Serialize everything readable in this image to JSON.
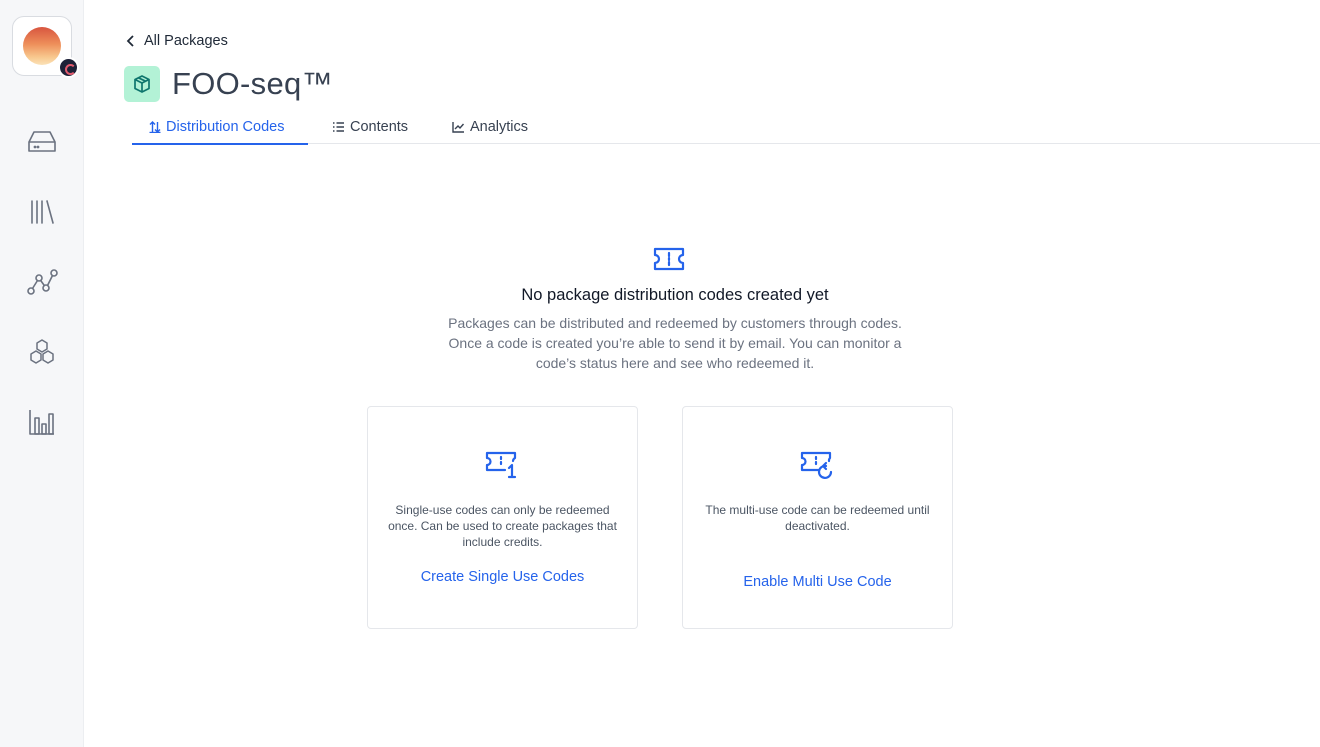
{
  "sidebar": {
    "items": [
      {
        "icon": "inbox-icon"
      },
      {
        "icon": "library-icon"
      },
      {
        "icon": "workflow-icon"
      },
      {
        "icon": "hexagons-icon"
      },
      {
        "icon": "bar-chart-icon"
      }
    ]
  },
  "header": {
    "back_label": "All Packages",
    "title": "FOO-seq™"
  },
  "tabs": [
    {
      "label": "Distribution Codes",
      "active": true
    },
    {
      "label": "Contents",
      "active": false
    },
    {
      "label": "Analytics",
      "active": false
    }
  ],
  "empty_state": {
    "title": "No package distribution codes created yet",
    "description": "Packages can be distributed and redeemed by customers through codes. Once a code is created you’re able to send it by email. You can monitor a code’s status here and see who redeemed it."
  },
  "cards": {
    "single": {
      "description": "Single-use codes can only be redeemed once. Can be used to create packages that include credits.",
      "action": "Create Single Use Codes"
    },
    "multi": {
      "description": "The multi-use code can be redeemed until deactivated.",
      "action": "Enable Multi Use Code"
    }
  },
  "colors": {
    "accent": "#2563eb",
    "package_icon_bg": "#b3f2d6",
    "sidebar_bg": "#f6f7f9"
  }
}
